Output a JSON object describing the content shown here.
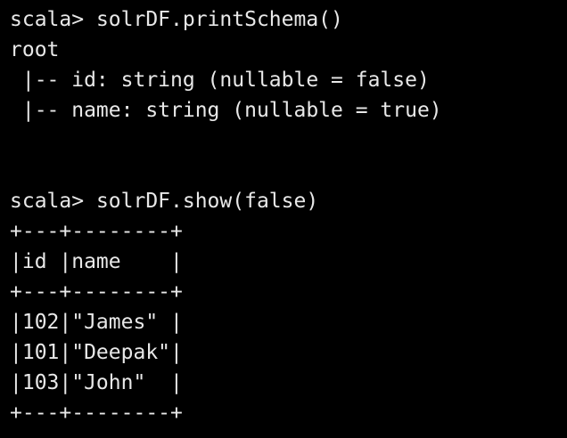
{
  "terminal": {
    "prompt": "scala> ",
    "lines": [
      "",
      "root",
      " |-- id: string (nullable = false)",
      " |-- name: string (nullable = true)",
      "",
      "",
      "",
      "+---+--------+",
      "|id |name    |",
      "+---+--------+",
      "|102|\"James\" |",
      "|101|\"Deepak\"|",
      "|103|\"John\"  |",
      "+---+--------+"
    ],
    "commands": [
      "solrDF.printSchema()",
      "solrDF.show(false)"
    ]
  },
  "colors": {
    "background": "#000000",
    "text": "#e8e8e8"
  }
}
